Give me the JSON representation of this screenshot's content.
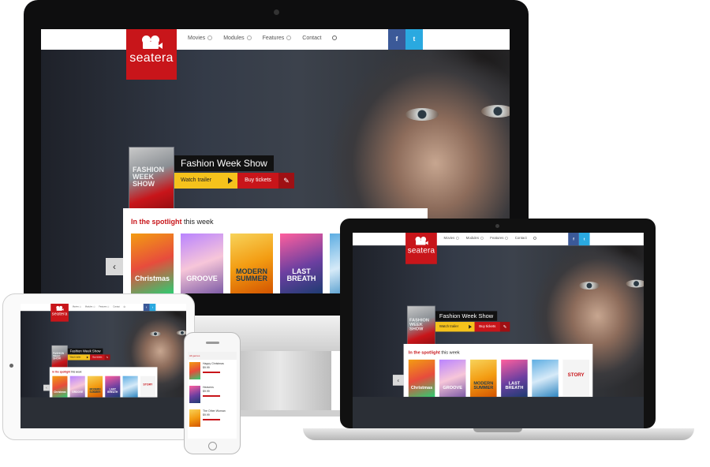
{
  "site": {
    "logo_text": "seatera",
    "nav": [
      {
        "label": "Movies",
        "has_dropdown": true
      },
      {
        "label": "Modules",
        "has_dropdown": true
      },
      {
        "label": "Features",
        "has_dropdown": true
      },
      {
        "label": "Contact",
        "has_dropdown": false
      }
    ],
    "social": {
      "facebook": "f",
      "twitter": "t"
    },
    "featured": {
      "title": "Fashion Week Show",
      "poster_text": "FASHION WEEK SHOW",
      "watch_label": "Watch trailer",
      "buy_label": "Buy tickets"
    },
    "spotlight": {
      "highlight": "In the spotlight",
      "rest": " this week"
    },
    "thumbnails": [
      {
        "text": "Christmas"
      },
      {
        "text": "GROOVE"
      },
      {
        "text": "MODERN SUMMER"
      },
      {
        "text": "LAST BREATH"
      },
      {
        "text": ""
      },
      {
        "text": "STORY"
      }
    ],
    "arrow_left": "‹"
  },
  "phone": {
    "header": "All genres",
    "items": [
      {
        "title": "Happy Christmas",
        "price": "$9.99"
      },
      {
        "title": "Heavens",
        "price": "$9.99"
      },
      {
        "title": "The Other Woman",
        "price": "$9.99"
      }
    ]
  },
  "colors": {
    "brand_red": "#c8151a",
    "accent_yellow": "#f5c21c",
    "facebook": "#3b5998",
    "twitter": "#2aa9e0"
  },
  "icons": [
    "video-camera-icon",
    "search-icon",
    "facebook-icon",
    "twitter-icon",
    "play-icon",
    "ticket-icon",
    "chevron-left-icon"
  ]
}
